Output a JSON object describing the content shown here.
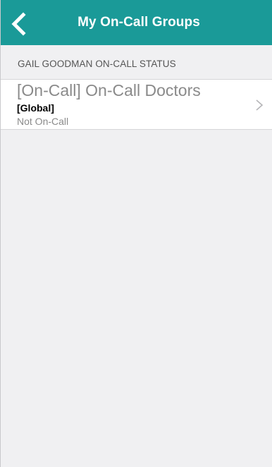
{
  "nav": {
    "title": "My On-Call Groups",
    "back_icon": "chevron-left-icon",
    "bar_color": "#1a9a98"
  },
  "section": {
    "header": "GAIL GOODMAN ON-CALL STATUS"
  },
  "groups": [
    {
      "title": "[On-Call] On-Call Doctors",
      "scope": "[Global]",
      "status": "Not On-Call",
      "icon": "chevron-right-icon"
    }
  ]
}
